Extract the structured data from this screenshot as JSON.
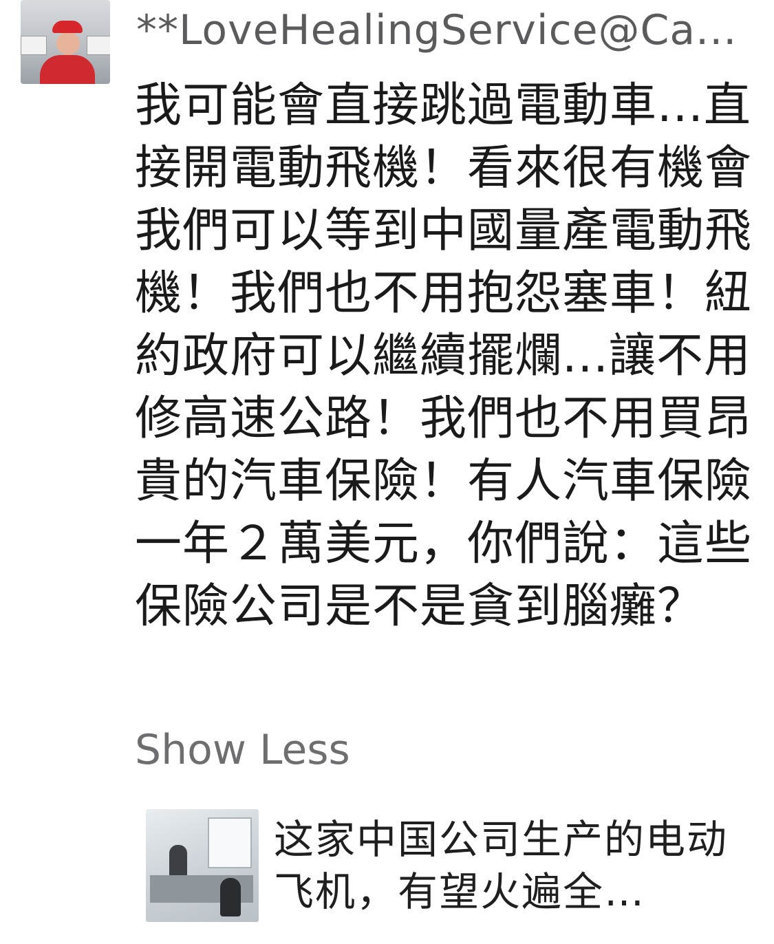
{
  "comment": {
    "author": "**LoveHealingService@Ca...",
    "text": "我可能會直接跳過電動車...直接開電動飛機！看來很有機會我們可以等到中國量產電動飛機！我們也不用抱怨塞車！紐約政府可以繼續擺爛...讓不用修高速公路！我們也不用買昂貴的汽車保險！有人汽車保險一年２萬美元，你們說：這些保險公司是不是貪到腦癱？",
    "show_less_label": "Show Less"
  },
  "link_preview": {
    "title": "这家中国公司生产的电动飞机，有望火遍全球，..."
  }
}
